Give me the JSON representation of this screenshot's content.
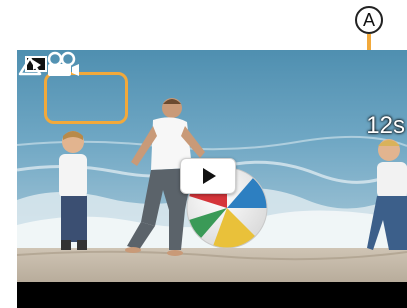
{
  "callout": {
    "label": "A"
  },
  "screen": {
    "mode_icon": "playback-mode-icon",
    "motion_picture_icon": "motion-picture-icon",
    "duration": "12s",
    "play_icon": "play-icon",
    "highlight_color": "#f2a93b"
  }
}
